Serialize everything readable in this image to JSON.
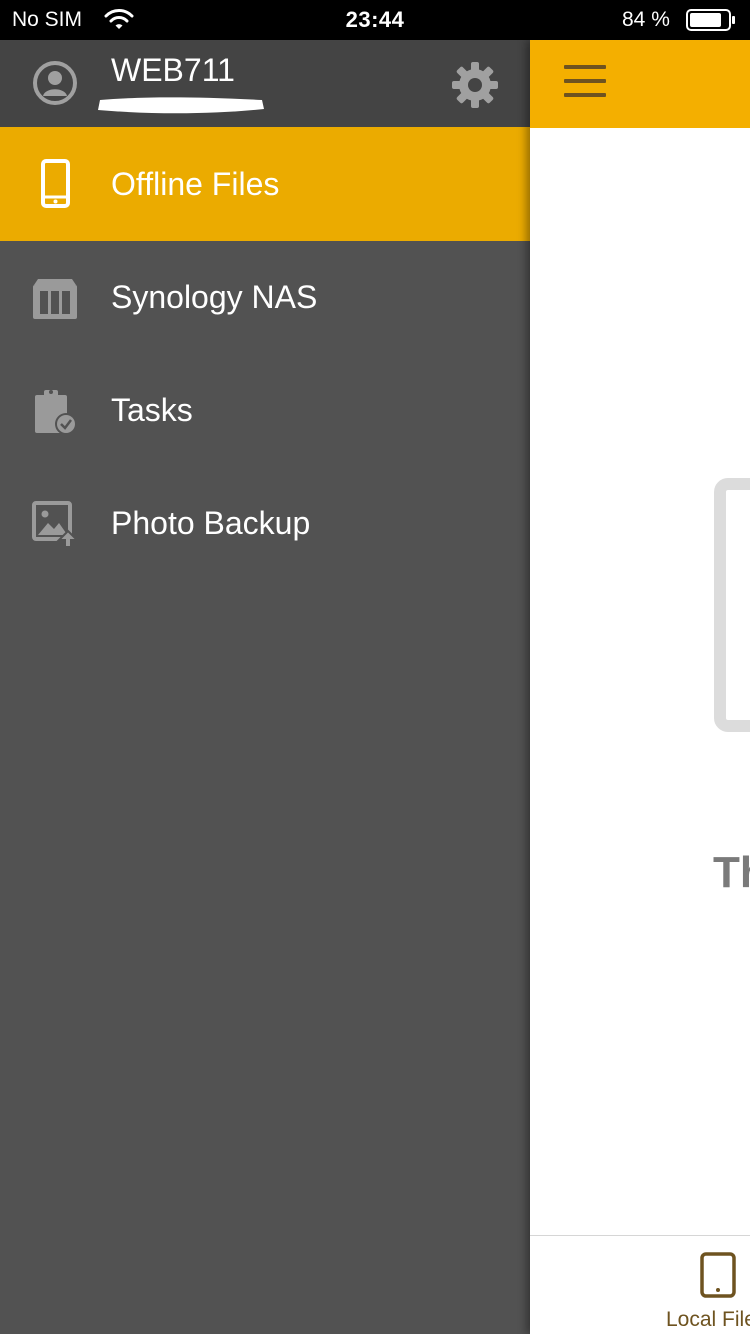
{
  "status_bar": {
    "carrier": "No SIM",
    "time": "23:44",
    "battery_percent": "84 %",
    "battery_level": 0.84
  },
  "drawer": {
    "username": "WEB711",
    "menu": [
      {
        "label": "Offline Files",
        "icon": "smartphone-icon",
        "active": true
      },
      {
        "label": "Synology NAS",
        "icon": "nas-server-icon",
        "active": false
      },
      {
        "label": "Tasks",
        "icon": "clipboard-check-icon",
        "active": false
      },
      {
        "label": "Photo Backup",
        "icon": "photo-upload-icon",
        "active": false
      }
    ]
  },
  "main": {
    "empty_text": "Th",
    "bottom_tab_label": "Local File"
  },
  "colors": {
    "accent": "#EBAB00",
    "toolbar": "#F4AF00",
    "drawer_bg": "#525252",
    "drawer_header_bg": "#444444",
    "tab_text": "#6E5320"
  }
}
